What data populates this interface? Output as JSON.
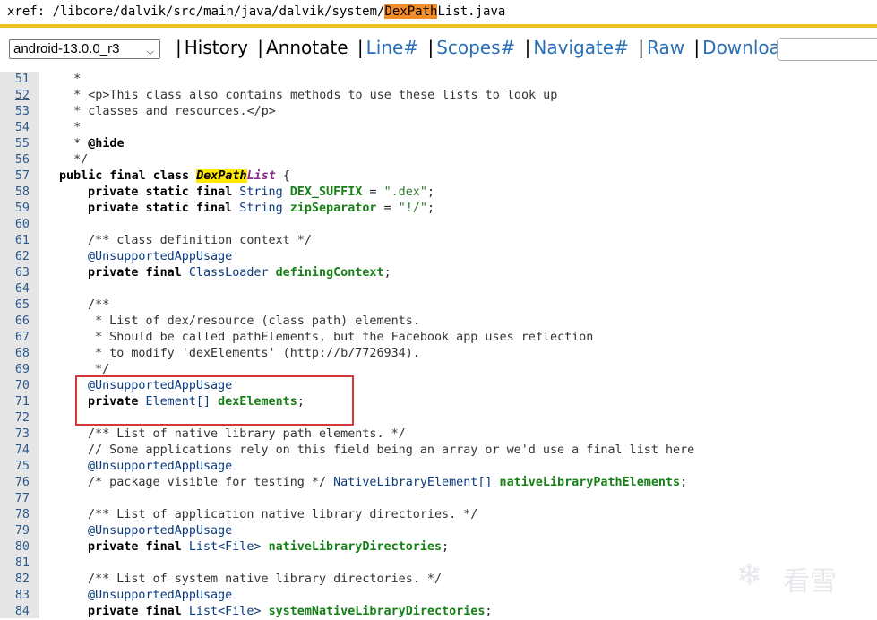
{
  "xref": {
    "prefix": "xref: ",
    "path": "/libcore/dalvik/src/main/java/dalvik/system/",
    "file_highlight": "DexPath",
    "file_rest": "List.java"
  },
  "nav": {
    "version_selected": "android-13.0.0_r3",
    "links": [
      "History",
      "Annotate",
      "Line#",
      "Scopes#",
      "Navigate#",
      "Raw",
      "Download"
    ],
    "separator": "|"
  },
  "code": {
    "line_numbers": [
      "51",
      "52",
      "53",
      "54",
      "55",
      "56",
      "57",
      "58",
      "59",
      "60",
      "61",
      "62",
      "63",
      "64",
      "65",
      "66",
      "67",
      "68",
      "69",
      "70",
      "71",
      "72",
      "73",
      "74",
      "75",
      "76",
      "77",
      "78",
      "79",
      "80",
      "81",
      "82",
      "83",
      "84"
    ],
    "lines": {
      "l51": "  *",
      "l52": "  * <p>This class also contains methods to use these lists to look up",
      "l53": "  * classes and resources.</p>",
      "l54": "  *",
      "l55a": "  * ",
      "l55b": "@hide",
      "l56": "  */",
      "l57a": "public final class",
      "l57b": "DexPath",
      "l57c": "List",
      "l57d": " {",
      "l58a": "private static final",
      "l58b": " String ",
      "l58c": "DEX_SUFFIX",
      "l58d": " = ",
      "l58e": "\".dex\"",
      "l58f": ";",
      "l59a": "private static final",
      "l59b": " String ",
      "l59c": "zipSeparator",
      "l59d": " = ",
      "l59e": "\"!/\"",
      "l59f": ";",
      "l61": "/** class definition context */",
      "l62": "@UnsupportedAppUsage",
      "l63a": "private final",
      "l63b": " ClassLoader ",
      "l63c": "definingContext",
      "l63d": ";",
      "l65": "/**",
      "l66": " * List of dex/resource (class path) elements.",
      "l67": " * Should be called pathElements, but the Facebook app uses reflection",
      "l68": " * to modify 'dexElements' (http://b/7726934).",
      "l69": " */",
      "l70": "@UnsupportedAppUsage",
      "l71a": "private",
      "l71b": " Element[] ",
      "l71c": "dexElements",
      "l71d": ";",
      "l73": "/** List of native library path elements. */",
      "l74": "// Some applications rely on this field being an array or we'd use a final list here",
      "l75": "@UnsupportedAppUsage",
      "l76a": "/* package visible for testing */",
      "l76b": " NativeLibraryElement[] ",
      "l76c": "nativeLibraryPathElements",
      "l76d": ";",
      "l78": "/** List of application native library directories. */",
      "l79": "@UnsupportedAppUsage",
      "l80a": "private final",
      "l80b": " List<File> ",
      "l80c": "nativeLibraryDirectories",
      "l80d": ";",
      "l82": "/** List of system native library directories. */",
      "l83": "@UnsupportedAppUsage",
      "l84a": "private final",
      "l84b": " List<File> ",
      "l84c": "systemNativeLibraryDirectories",
      "l84d": ";"
    }
  },
  "watermark": {
    "icon": "snowflake-icon",
    "text": "看雪"
  },
  "colors": {
    "accent_rule": "#f0c020",
    "highlight": "#f28c28",
    "class_highlight": "#ffe800",
    "red_box": "#d23a3a",
    "link_blue": "#2a6fb6"
  }
}
